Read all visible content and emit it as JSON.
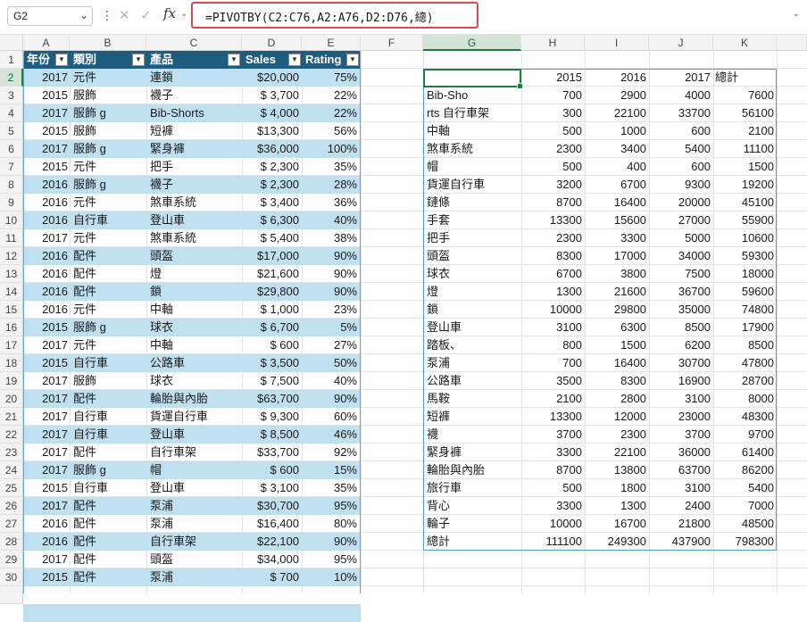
{
  "formula_bar": {
    "name_box": "G2",
    "formula": "=PIVOTBY(C2:C76,A2:A76,D2:D76,總)"
  },
  "icons": {
    "cancel": "close-icon",
    "enter": "check-icon",
    "function": "fx-icon"
  },
  "columns": [
    "A",
    "B",
    "C",
    "D",
    "E",
    "F",
    "G",
    "H",
    "I",
    "J",
    "K"
  ],
  "rows": [
    "1",
    "2",
    "3",
    "4",
    "5",
    "6",
    "7",
    "8",
    "9",
    "10",
    "11",
    "12",
    "13",
    "14",
    "15",
    "16",
    "17",
    "18",
    "19",
    "20",
    "21",
    "22",
    "23",
    "24",
    "25",
    "26",
    "27",
    "28",
    "29",
    "30"
  ],
  "table": {
    "headers": [
      "年份",
      "類別",
      "產品",
      "Sales",
      "Rating"
    ],
    "rows": [
      [
        "2017",
        "元件",
        "連鎖",
        "$20,000",
        "75%"
      ],
      [
        "2015",
        "服飾",
        "襪子",
        "$ 3,700",
        "22%"
      ],
      [
        "2017",
        "服飾 g",
        "Bib-Shorts",
        "$ 4,000",
        "22%"
      ],
      [
        "2015",
        "服飾",
        "短褲",
        "$13,300",
        "56%"
      ],
      [
        "2017",
        "服飾 g",
        "緊身褲",
        "$36,000",
        "100%"
      ],
      [
        "2015",
        "元件",
        "把手",
        "$ 2,300",
        "35%"
      ],
      [
        "2016",
        "服飾 g",
        "襪子",
        "$ 2,300",
        "28%"
      ],
      [
        "2016",
        "元件",
        "煞車系統",
        "$ 3,400",
        "36%"
      ],
      [
        "2016",
        "自行車",
        "登山車",
        "$ 6,300",
        "40%"
      ],
      [
        "2017",
        "元件",
        "煞車系統",
        "$ 5,400",
        "38%"
      ],
      [
        "2016",
        "配件",
        "頭盔",
        "$17,000",
        "90%"
      ],
      [
        "2016",
        "配件",
        "燈",
        "$21,600",
        "90%"
      ],
      [
        "2016",
        "配件",
        "鎖",
        "$29,800",
        "90%"
      ],
      [
        "2016",
        "元件",
        "中軸",
        "$ 1,000",
        "23%"
      ],
      [
        "2015",
        "服飾 g",
        "球衣",
        "$ 6,700",
        "5%"
      ],
      [
        "2017",
        "元件",
        "中軸",
        "$ 600",
        "27%"
      ],
      [
        "2015",
        "自行車",
        "公路車",
        "$ 3,500",
        "50%"
      ],
      [
        "2017",
        "服飾",
        "球衣",
        "$ 7,500",
        "40%"
      ],
      [
        "2017",
        "配件",
        "輪胎與內胎",
        "$63,700",
        "90%"
      ],
      [
        "2017",
        "自行車",
        "貨運自行車",
        "$ 9,300",
        "60%"
      ],
      [
        "2017",
        "自行車",
        "登山車",
        "$ 8,500",
        "46%"
      ],
      [
        "2017",
        "配件",
        "自行車架",
        "$33,700",
        "92%"
      ],
      [
        "2017",
        "服飾 g",
        "帽",
        "$ 600",
        "15%"
      ],
      [
        "2015",
        "自行車",
        "登山車",
        "$ 3,100",
        "35%"
      ],
      [
        "2017",
        "配件",
        "泵浦",
        "$30,700",
        "95%"
      ],
      [
        "2016",
        "配件",
        "泵浦",
        "$16,400",
        "80%"
      ],
      [
        "2016",
        "配件",
        "自行車架",
        "$22,100",
        "90%"
      ],
      [
        "2017",
        "配件",
        "頭盔",
        "$34,000",
        "95%"
      ],
      [
        "2015",
        "配件",
        "泵浦",
        "$ 700",
        "10%"
      ]
    ]
  },
  "pivot": {
    "header": [
      "",
      "2015",
      "2016",
      "2017",
      "總計"
    ],
    "rows": [
      [
        "Bib-Sho",
        "700",
        "2900",
        "4000",
        "7600"
      ],
      [
        "rts 自行車架",
        "300",
        "22100",
        "33700",
        "56100"
      ],
      [
        "中軸",
        "500",
        "1000",
        "600",
        "2100"
      ],
      [
        "煞車系統",
        "2300",
        "3400",
        "5400",
        "11100"
      ],
      [
        "帽",
        "500",
        "400",
        "600",
        "1500"
      ],
      [
        "貨運自行車",
        "3200",
        "6700",
        "9300",
        "19200"
      ],
      [
        "鏈條",
        "8700",
        "16400",
        "20000",
        "45100"
      ],
      [
        "手套",
        "13300",
        "15600",
        "27000",
        "55900"
      ],
      [
        "把手",
        "2300",
        "3300",
        "5000",
        "10600"
      ],
      [
        "頭盔",
        "8300",
        "17000",
        "34000",
        "59300"
      ],
      [
        "球衣",
        "6700",
        "3800",
        "7500",
        "18000"
      ],
      [
        "燈",
        "1300",
        "21600",
        "36700",
        "59600"
      ],
      [
        "鎖",
        "10000",
        "29800",
        "35000",
        "74800"
      ],
      [
        "登山車",
        "3100",
        "6300",
        "8500",
        "17900"
      ],
      [
        "踏板、",
        "800",
        "1500",
        "6200",
        "8500"
      ],
      [
        "泵浦",
        "700",
        "16400",
        "30700",
        "47800"
      ],
      [
        "公路車",
        "3500",
        "8300",
        "16900",
        "28700"
      ],
      [
        "馬鞍",
        "2100",
        "2800",
        "3100",
        "8000"
      ],
      [
        "短褲",
        "13300",
        "12000",
        "23000",
        "48300"
      ],
      [
        "襪",
        "3700",
        "2300",
        "3700",
        "9700"
      ],
      [
        "緊身褲",
        "3300",
        "22100",
        "36000",
        "61400"
      ],
      [
        "輪胎與內胎",
        "8700",
        "13800",
        "63700",
        "86200"
      ],
      [
        "旅行車",
        "500",
        "1800",
        "3100",
        "5400"
      ],
      [
        "背心",
        "3300",
        "1300",
        "2400",
        "7000"
      ],
      [
        "輪子",
        "10000",
        "16700",
        "21800",
        "48500"
      ],
      [
        "總計",
        "111100",
        "249300",
        "437900",
        "798300"
      ]
    ]
  },
  "colors": {
    "table_header": "#1f5d80",
    "band": "#bfe0f0",
    "formula_highlight": "#e0474c",
    "selection": "#1f7a43"
  }
}
